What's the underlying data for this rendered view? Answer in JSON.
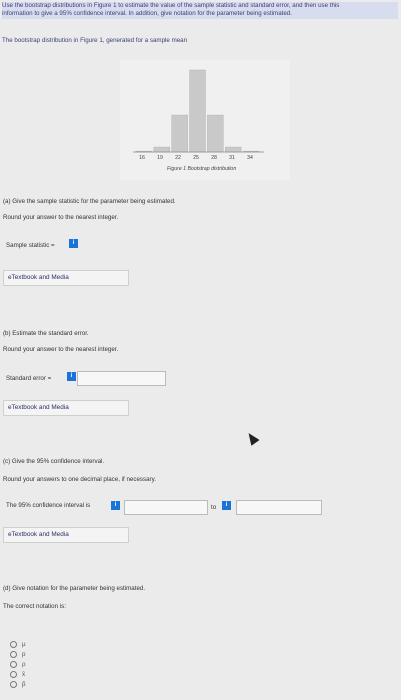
{
  "intro": {
    "line1": "Use the bootstrap distributions in Figure 1 to estimate the value of the sample statistic and standard error, and then use this",
    "line2": "information to give a 95% confidence interval. In addition, give notation for the parameter being estimated."
  },
  "figure": {
    "caption_line": "The bootstrap distribution in Figure 1, generated for a sample mean",
    "tick_labels": [
      "16",
      "19",
      "22",
      "25",
      "28",
      "31",
      "34"
    ],
    "title": "Figure 1 Bootstrap distribution"
  },
  "part_a": {
    "title": "(a) Give the sample statistic for the parameter being estimated.",
    "round": "Round your answer to the nearest integer.",
    "label": "Sample statistic =",
    "info": "i",
    "etext": "eTextbook and Media"
  },
  "part_b": {
    "title": "(b) Estimate the standard error.",
    "round": "Round your answer to the nearest integer.",
    "label": "Standard error =",
    "info": "i",
    "etext": "eTextbook and Media"
  },
  "part_c": {
    "title": "(c) Give the 95% confidence interval.",
    "round": "Round your answers to one decimal place, if necessary.",
    "label": "The 95% confidence interval is",
    "info": "i",
    "to": "to",
    "info2": "i",
    "etext": "eTextbook and Media"
  },
  "part_d": {
    "title": "(d) Give notation for the parameter being estimated.",
    "label": "The correct notation is:",
    "options": [
      "μ",
      "p",
      "ρ",
      "x̄",
      "p̂"
    ]
  },
  "chart_data": {
    "type": "bar",
    "categories": [
      "16",
      "19",
      "22",
      "25",
      "28",
      "31",
      "34"
    ],
    "values": [
      1,
      6,
      45,
      100,
      45,
      6,
      1
    ],
    "title": "Figure 1 Bootstrap distribution",
    "xlabel": "",
    "ylabel": "",
    "ylim": [
      0,
      100
    ]
  }
}
